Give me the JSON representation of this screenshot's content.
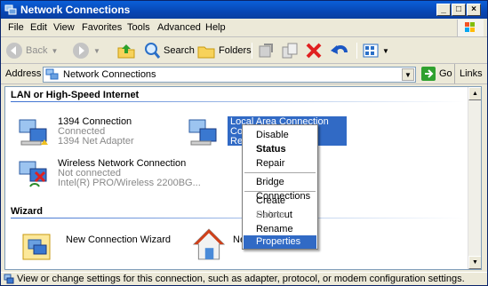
{
  "window": {
    "title": "Network Connections"
  },
  "menu": [
    "File",
    "Edit",
    "View",
    "Favorites",
    "Tools",
    "Advanced",
    "Help"
  ],
  "toolbar": {
    "back": "Back",
    "search": "Search",
    "folders": "Folders"
  },
  "address": {
    "label": "Address",
    "value": "Network Connections",
    "go": "Go",
    "links": "Links"
  },
  "groups": {
    "lan": "LAN or High-Speed Internet",
    "wizard": "Wizard"
  },
  "items": {
    "c1394": {
      "name": "1394 Connection",
      "status": "Connected",
      "device": "1394 Net Adapter"
    },
    "wireless": {
      "name": "Wireless Network Connection",
      "status": "Not connected",
      "device": "Intel(R) PRO/Wireless 2200BG..."
    },
    "lan": {
      "name": "Local Area Connection",
      "line2": "Con",
      "line3": "Rea"
    },
    "ncw": {
      "name": "New Connection Wizard"
    },
    "nsw": {
      "name": "Net"
    }
  },
  "context_menu": {
    "disable": "Disable",
    "status": "Status",
    "repair": "Repair",
    "bridge": "Bridge Connections",
    "shortcut": "Create Shortcut",
    "delete": "Delete",
    "rename": "Rename",
    "properties": "Properties"
  },
  "statusbar": {
    "text": "View or change settings for this connection, such as adapter, protocol, or modem configuration settings."
  },
  "colors": {
    "title_bar": "#0847b5",
    "selection": "#316ac5",
    "group_line": "#3a6fd0"
  },
  "icons": [
    "network-connections-icon",
    "back-arrow-icon",
    "forward-arrow-icon",
    "up-folder-icon",
    "search-icon",
    "folders-icon",
    "move-to-icon",
    "copy-to-icon",
    "delete-x-icon",
    "undo-icon",
    "views-icon",
    "go-arrow-icon",
    "network-computer-icon",
    "wireless-icon",
    "wizard-icon",
    "home-network-icon",
    "info-icon"
  ]
}
